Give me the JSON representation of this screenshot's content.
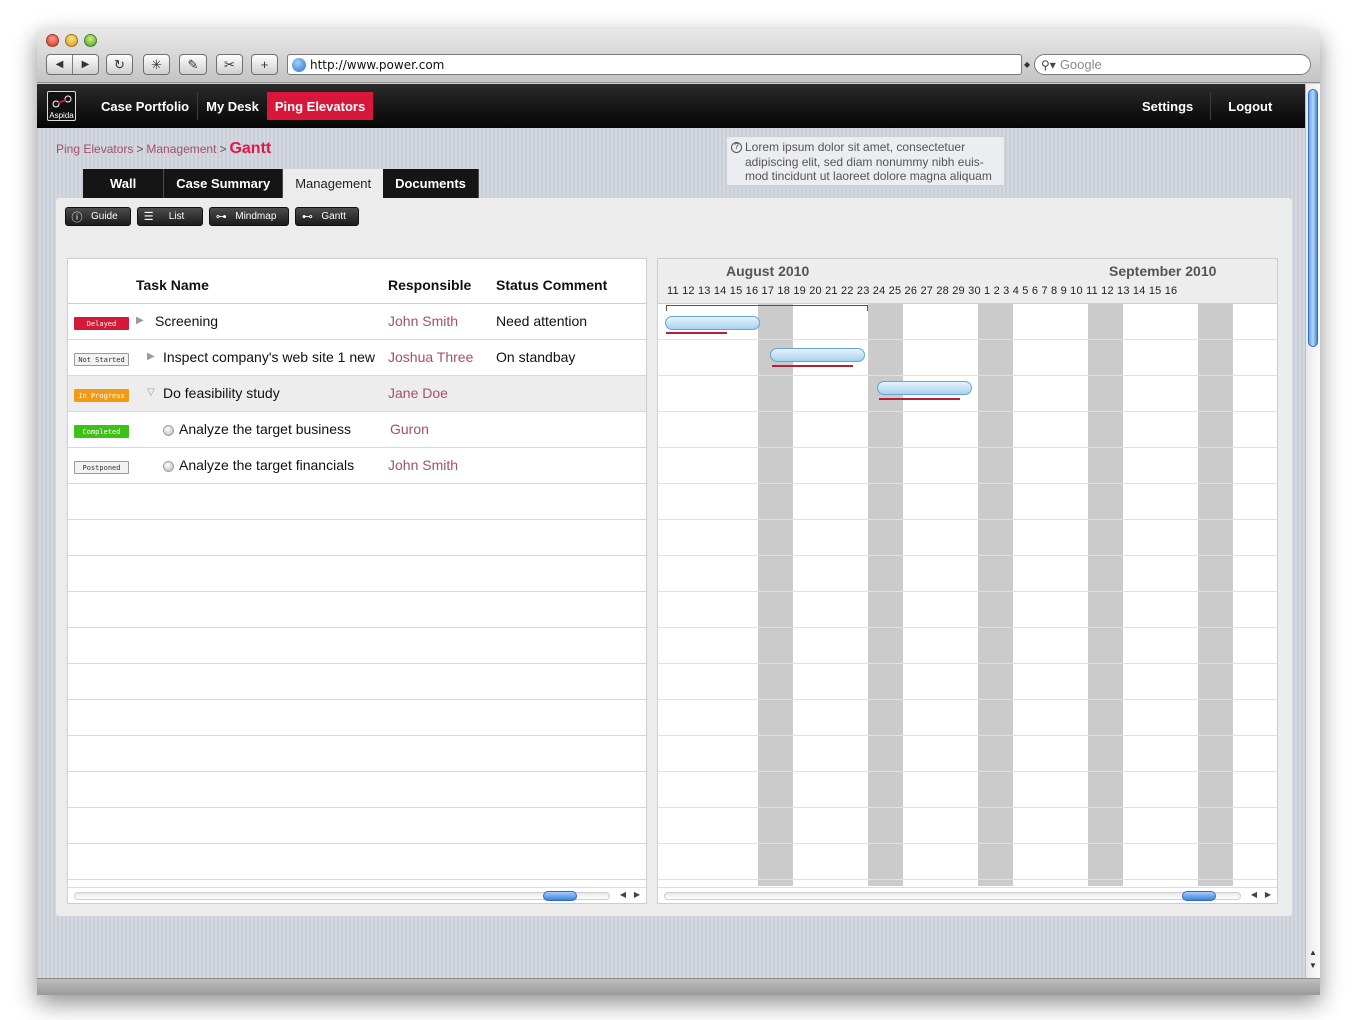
{
  "browser": {
    "url": "http://www.power.com",
    "search_placeholder": "Google"
  },
  "app": {
    "logo_label": "Aspida",
    "nav": [
      "Case Portfolio",
      "My Desk",
      "Ping Elevators"
    ],
    "nav_active": "Ping Elevators",
    "nav_right": [
      "Settings",
      "Logout"
    ]
  },
  "breadcrumb": {
    "items": [
      "Ping Elevators",
      "Management"
    ],
    "separator": ">",
    "current": "Gantt"
  },
  "tooltip": {
    "lines": [
      "Lorem ipsum dolor sit amet, consectetuer",
      "adipiscing elit, sed diam nonummy nibh euis-",
      "mod tincidunt ut laoreet dolore magna aliquam"
    ]
  },
  "tabs": [
    "Wall",
    "Case Summary",
    "Management",
    "Documents"
  ],
  "tab_active": "Management",
  "view_buttons": [
    "Guide",
    "List",
    "Mindmap",
    "Gantt"
  ],
  "grid": {
    "headers": {
      "task": "Task Name",
      "responsible": "Responsible",
      "status": "Status Comment"
    },
    "rows": [
      {
        "badge": "Delayed",
        "badge_color": "#d41a36",
        "task": "Screening",
        "responsible": "John Smith",
        "comment": "Need attention"
      },
      {
        "badge": "Not Started",
        "badge_color": "#f2f2f2",
        "task": "Inspect company's web site 1 new",
        "responsible": "Joshua Three",
        "comment": "On standbay"
      },
      {
        "badge": "In Progress",
        "badge_color": "#f19a16",
        "task": "Do feasibility study",
        "responsible": "Jane Doe",
        "comment": ""
      },
      {
        "badge": "Completed",
        "badge_color": "#3fbf1a",
        "task": "Analyze the target business",
        "responsible": "Guron",
        "comment": ""
      },
      {
        "badge": "Postponed",
        "badge_color": "#f2f2f2",
        "task": "Analyze the target financials",
        "responsible": "John Smith",
        "comment": ""
      }
    ]
  },
  "gantt": {
    "months": [
      "August 2010",
      "September 2010"
    ],
    "days": "11 12 13 14 15 16 17 18 19 20 21 22 23 24 25 26 27 28 29 30  1 2 3 4 5 6 7 8 9 10 11 12 13 14 15 16"
  },
  "colors": {
    "accent": "#d8183a",
    "link": "#a5506a",
    "topbar": "#111111"
  }
}
